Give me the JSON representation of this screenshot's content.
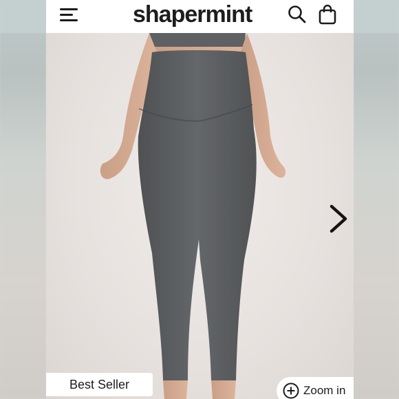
{
  "header": {
    "brand": "shapermint",
    "menu_icon": "hamburger-menu-icon",
    "search_icon": "search-icon",
    "bag_icon": "shopping-bag-icon"
  },
  "product": {
    "badge": "Best Seller",
    "zoom_label": "Zoom in",
    "next_icon": "chevron-right-icon",
    "zoom_icon": "plus-circle-icon"
  },
  "colors": {
    "header_bg": "#ffffff",
    "text": "#1b1b1b",
    "leggings": "#5b5d5f",
    "background": "#ece8e5"
  }
}
